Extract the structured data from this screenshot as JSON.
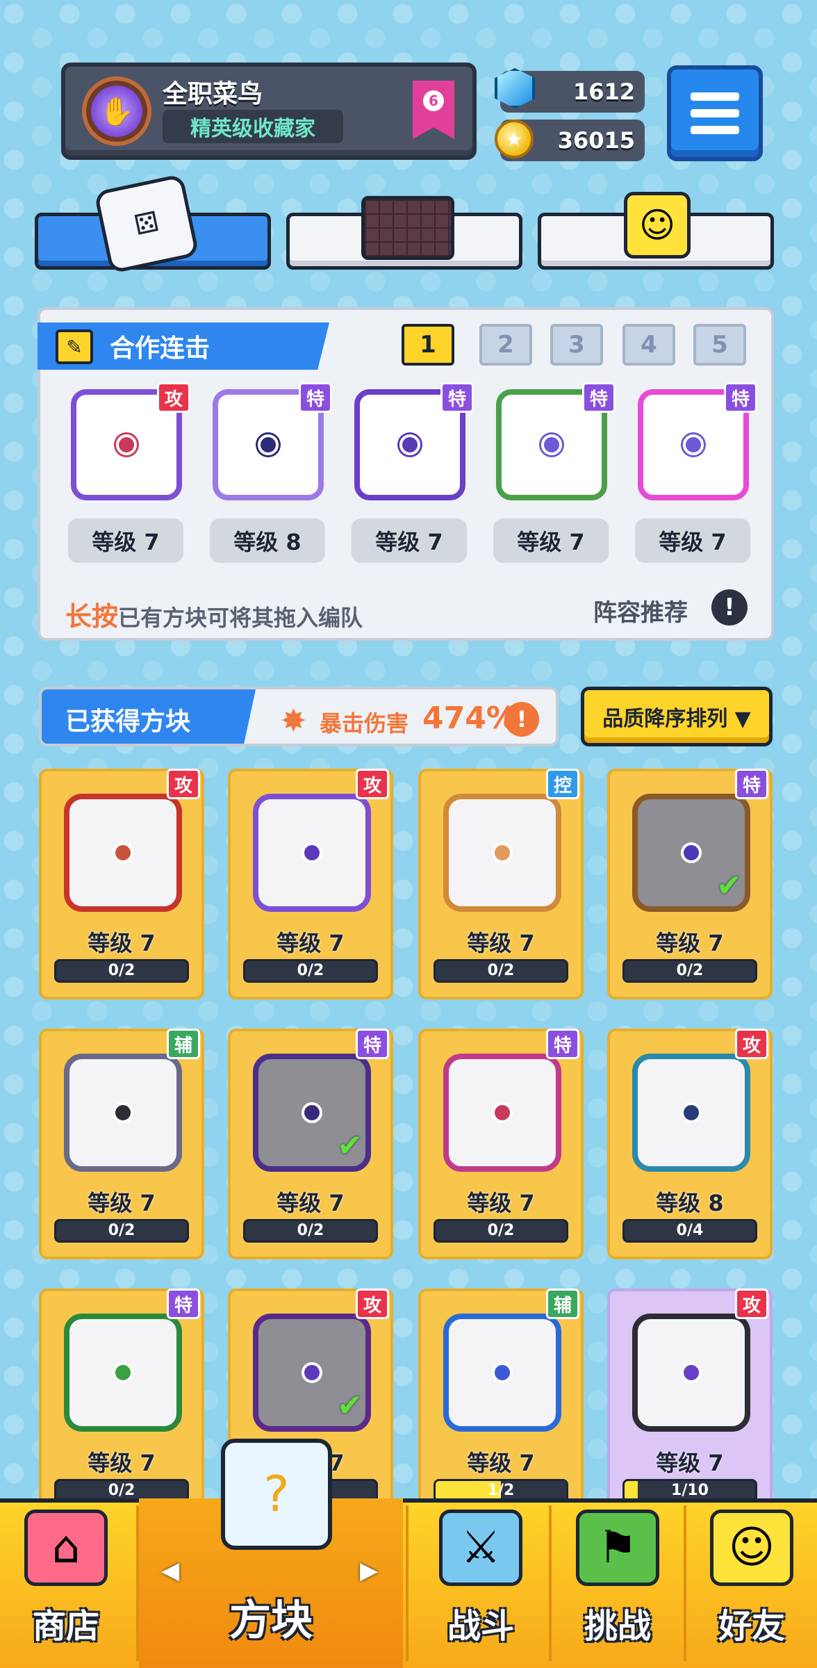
{
  "player": {
    "name": "全职菜鸟",
    "title": "精英级收藏家",
    "rank": "6"
  },
  "currency": {
    "gems": "1612",
    "coins": "36015"
  },
  "combo_panel": {
    "title": "合作连击",
    "pages": [
      "1",
      "2",
      "3",
      "4",
      "5"
    ],
    "active_page": "1",
    "slots": [
      {
        "tag": "攻",
        "tag_color": "#e8334a",
        "level": "等级 7",
        "frame": "#7d4fd4",
        "core": "#c83a5a"
      },
      {
        "tag": "特",
        "tag_color": "#8b4fe0",
        "level": "等级 8",
        "frame": "#9c7ae6",
        "core": "#2c2a7a"
      },
      {
        "tag": "特",
        "tag_color": "#8b4fe0",
        "level": "等级 7",
        "frame": "#6a3fc8",
        "core": "#5b3ab8"
      },
      {
        "tag": "特",
        "tag_color": "#8b4fe0",
        "level": "等级 7",
        "frame": "#4aa04a",
        "core": "#6b5ad8"
      },
      {
        "tag": "特",
        "tag_color": "#8b4fe0",
        "level": "等级 7",
        "frame": "#e84ad8",
        "core": "#6b5ad8"
      }
    ],
    "hint_emphasis": "长按",
    "hint_rest": "已有方块可将其拖入编队",
    "recommend": "阵容推荐"
  },
  "collection": {
    "title": "已获得方块",
    "crit_label": "暴击伤害",
    "crit_value": "474%",
    "sort_label": "品质降序排列 ▼",
    "cards": [
      {
        "tag": "攻",
        "tag_color": "#e8334a",
        "level": "等级 7",
        "progress": "0/2",
        "frame": "#c8342a",
        "core": "#c8543a",
        "owned": false
      },
      {
        "tag": "攻",
        "tag_color": "#e8334a",
        "level": "等级 7",
        "progress": "0/2",
        "frame": "#7d4fd4",
        "core": "#5b3ab8",
        "owned": false
      },
      {
        "tag": "控",
        "tag_color": "#2f9ae8",
        "level": "等级 7",
        "progress": "0/2",
        "frame": "#d08a3a",
        "core": "#e09a5a",
        "owned": false
      },
      {
        "tag": "特",
        "tag_color": "#8b4fe0",
        "level": "等级 7",
        "progress": "0/2",
        "frame": "#8a5a2a",
        "core": "#4a3ab8",
        "owned": true
      },
      {
        "tag": "辅",
        "tag_color": "#3aa860",
        "level": "等级 7",
        "progress": "0/2",
        "frame": "#6a6a88",
        "core": "#2c2c34",
        "owned": false
      },
      {
        "tag": "特",
        "tag_color": "#8b4fe0",
        "level": "等级 7",
        "progress": "0/2",
        "frame": "#4a2f8a",
        "core": "#3a2a7a",
        "owned": true
      },
      {
        "tag": "特",
        "tag_color": "#8b4fe0",
        "level": "等级 7",
        "progress": "0/2",
        "frame": "#c03a8a",
        "core": "#c83a5a",
        "owned": false
      },
      {
        "tag": "攻",
        "tag_color": "#e8334a",
        "level": "等级 8",
        "progress": "0/4",
        "frame": "#2a8aaa",
        "core": "#2a3a7a",
        "owned": false
      },
      {
        "tag": "特",
        "tag_color": "#8b4fe0",
        "level": "等级 7",
        "progress": "0/2",
        "frame": "#2a8a3a",
        "core": "#3aa040",
        "owned": false
      },
      {
        "tag": "攻",
        "tag_color": "#e8334a",
        "level": "等级 7",
        "progress": "",
        "frame": "#5a2a8a",
        "core": "#5b3ab8",
        "owned": true
      },
      {
        "tag": "辅",
        "tag_color": "#3aa860",
        "level": "等级 7",
        "progress": "1/2",
        "frame": "#2a6ad8",
        "core": "#3a5ad8",
        "owned": false,
        "fill": 0.5
      },
      {
        "tag": "攻",
        "tag_color": "#e8334a",
        "level": "等级 7",
        "progress": "1/10",
        "frame": "#2c2c34",
        "core": "#6a3fc8",
        "owned": false,
        "epic": true,
        "fill": 0.1
      }
    ]
  },
  "nav": {
    "shop": "商店",
    "blocks": "方块",
    "battle": "战斗",
    "challenge": "挑战",
    "friends": "好友"
  }
}
